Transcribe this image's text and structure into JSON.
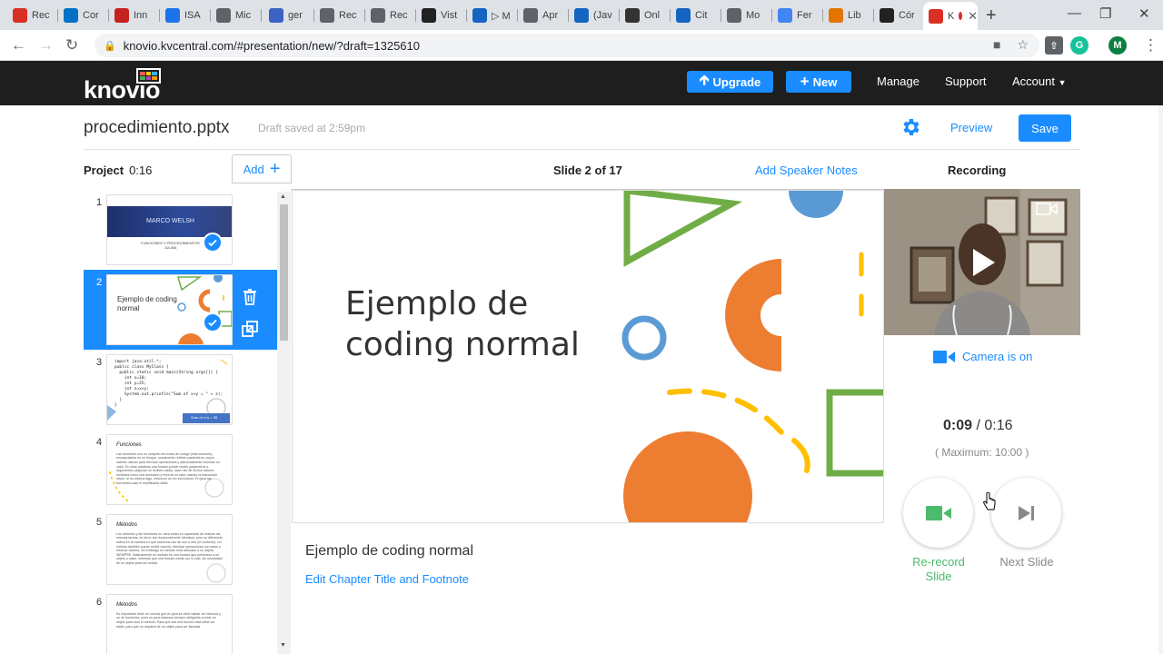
{
  "browser": {
    "tabs": [
      {
        "label": "Rec",
        "icon": "gmail-icon",
        "color": "#d93025"
      },
      {
        "label": "Cor",
        "icon": "outlook-icon",
        "color": "#0072c6"
      },
      {
        "label": "Inn",
        "icon": "nature-icon",
        "color": "#c5221f"
      },
      {
        "label": "ISA",
        "icon": "isa-icon",
        "color": "#1a73e8"
      },
      {
        "label": "Mic",
        "icon": "chrome-icon",
        "color": "#5f6368"
      },
      {
        "label": "ger",
        "icon": "gem-icon",
        "color": "#3b63c4"
      },
      {
        "label": "Rec",
        "icon": "chrome-icon",
        "color": "#5f6368"
      },
      {
        "label": "Rec",
        "icon": "chrome-icon",
        "color": "#5f6368"
      },
      {
        "label": "Vist",
        "icon": "pkp-icon",
        "color": "#222222"
      },
      {
        "label": "▷ M",
        "icon": "jstor-icon",
        "color": "#1565c0"
      },
      {
        "label": "Apr",
        "icon": "doc-icon",
        "color": "#5f6368"
      },
      {
        "label": "(Jav",
        "icon": "circle-c-icon",
        "color": "#1565c0"
      },
      {
        "label": "Onl",
        "icon": "coffee-icon",
        "color": "#333333"
      },
      {
        "label": "Cit",
        "icon": "book-icon",
        "color": "#1565c0"
      },
      {
        "label": "Mo",
        "icon": "chrome-icon",
        "color": "#5f6368"
      },
      {
        "label": "Fer",
        "icon": "google-icon",
        "color": "#4285f4"
      },
      {
        "label": "Lib",
        "icon": "lib-icon",
        "color": "#e37400"
      },
      {
        "label": "Cór",
        "icon": "square-icon",
        "color": "#222222"
      },
      {
        "label": "K",
        "icon": "knovio-icon",
        "color": "#d93025"
      }
    ],
    "url": "knovio.kvcentral.com/#presentation/new/?draft=1325610",
    "profile_initial": "M"
  },
  "header": {
    "logo": "knovio",
    "upgrade": "Upgrade",
    "new": "New",
    "manage": "Manage",
    "support": "Support",
    "account": "Account"
  },
  "titlebar": {
    "title": "procedimiento.pptx",
    "draft_saved": "Draft saved at 2:59pm",
    "preview": "Preview",
    "save": "Save"
  },
  "subheader": {
    "project_label": "Project",
    "project_time": "0:16",
    "add": "Add",
    "slide_count": "Slide 2 of 17",
    "speaker_notes": "Add Speaker Notes",
    "recording": "Recording"
  },
  "slides": [
    {
      "number": "1",
      "title": "MARCO WELSH",
      "subtitle": "FUNCIONES Y PROCEDIMIENTOS\nJULIAN"
    },
    {
      "number": "2",
      "title": "Ejemplo de coding normal"
    },
    {
      "number": "3",
      "code": "import java.util.*;\npublic class MyClass {\n  public static void main(String args[]) {\n    int x=10;\n    int y=25;\n    int z=x+y;\n    System.out.println(\"Sum of x+y = \" + z);\n  }\n}",
      "button": "Sum of x+y = 35"
    },
    {
      "number": "4",
      "title": "Funciones",
      "body": "Las funciones son un conjunto de líneas de código (instrucciones), encapsulados en un bloque, usualmente reciben parámetros, cuyos valores utilizan para efectuar operaciones y adicionalmente retornan un valor. En otras palabras una función puede recibir parámetros o argumentos (algunas no reciben nada), hace uso de dichos valores recibidos como sea necesario y retorna un valor usando la instrucción return, si no retorna algo, entonces no es una función. En java las funciones usan el modificador static."
    },
    {
      "number": "5",
      "title": "Métodos",
      "body": "Los métodos y las funciones en Java están en capacidad de realizar las mismas tareas, es decir, son funcionalmente idénticos, pero su diferencia radica en la manera en que hacemos uso de uno u otro (el contexto). Un método también puede recibir valores, efectuar operaciones con estos y retornar valores, sin embargo en método está asociado a un objeto, SIEMPRE. Básicamente un método es una función que pertenece a un objeto o clase, mientras que una función existe por sí sola, sin necesidad de un objeto para ser usada."
    },
    {
      "number": "6",
      "title": "Métodos",
      "body": "Es importante tener en cuenta que en java se debe hablar de métodos y no de funciones, pues en java estamos siempre obligados a crear un objeto para usar el método. Para que sea una función esta debe ser static, para que no requiera de un objeto para ser llamada."
    }
  ],
  "main_slide": {
    "title": "Ejemplo de coding normal",
    "title_line1": "Ejemplo de",
    "title_line2": "coding normal"
  },
  "chapter": {
    "title": "Ejemplo de coding normal",
    "edit_link": "Edit Chapter Title and Footnote"
  },
  "recording": {
    "camera_status": "Camera is on",
    "elapsed": "0:09",
    "total": "/ 0:16",
    "maximum": "( Maximum: 10:00 )",
    "rerecord": "Re-record Slide",
    "next": "Next Slide"
  },
  "colors": {
    "accent": "#1a8cff",
    "header_bg": "#1e1e1e",
    "green": "#4cbb6c",
    "orange": "#ed7d31",
    "slide_green": "#70ad47",
    "slide_blue": "#5b9bd5",
    "slide_yellow": "#ffc000"
  }
}
